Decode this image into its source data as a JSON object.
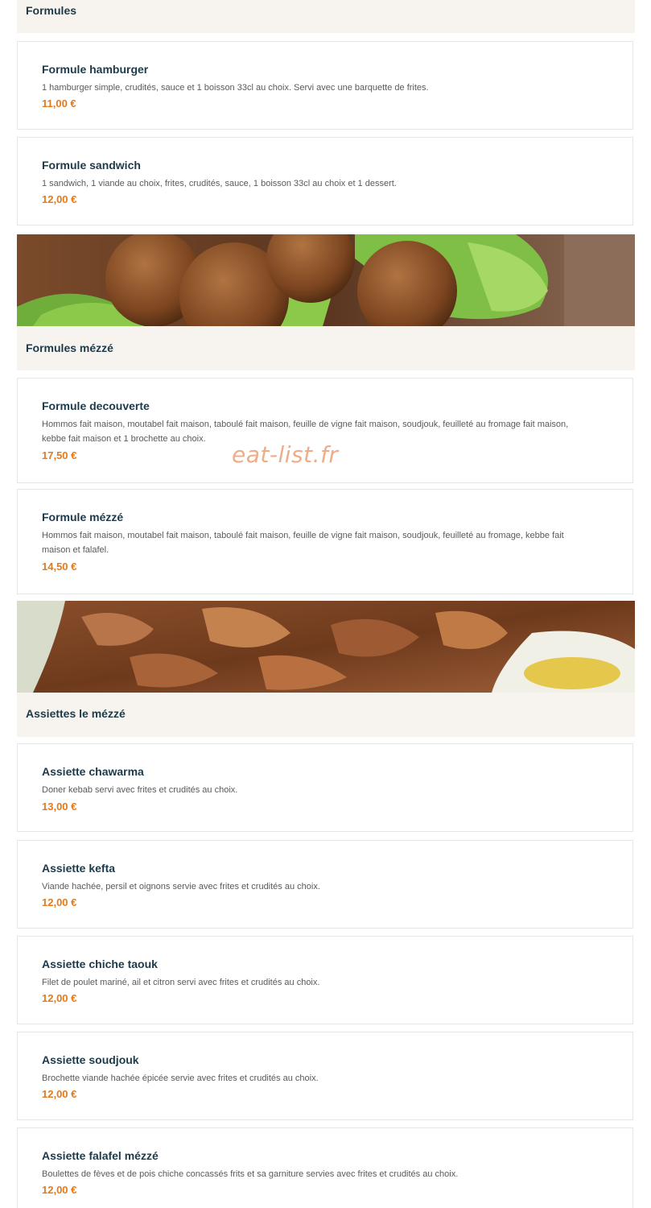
{
  "sections": [
    {
      "title": "Formules",
      "items": [
        {
          "name": "Formule hamburger",
          "desc": "1 hamburger simple, crudités, sauce et 1 boisson 33cl au choix. Servi avec une barquette de frites.",
          "price": "11,00 €"
        },
        {
          "name": "Formule sandwich",
          "desc": "1 sandwich, 1 viande au choix, frites, crudités, sauce, 1 boisson 33cl au choix et 1 dessert.",
          "price": "12,00 €"
        }
      ]
    },
    {
      "title": "Formules mézzé",
      "items": [
        {
          "name": "Formule decouverte",
          "desc": "Hommos fait maison, moutabel fait maison, taboulé fait maison, feuille de vigne fait maison, soudjouk, feuilleté au fromage fait maison, kebbe fait maison et 1 brochette au choix.",
          "price": "17,50 €"
        },
        {
          "name": "Formule mézzé",
          "desc": "Hommos fait maison, moutabel fait maison, taboulé fait maison, feuille de vigne fait maison, soudjouk, feuilleté au fromage, kebbe fait maison et falafel.",
          "price": "14,50 €"
        }
      ]
    },
    {
      "title": "Assiettes le mézzé",
      "items": [
        {
          "name": "Assiette chawarma",
          "desc": "Doner kebab servi avec frites et crudités au choix.",
          "price": "13,00 €"
        },
        {
          "name": "Assiette kefta",
          "desc": "Viande hachée, persil et oignons servie avec frites et crudités au choix.",
          "price": "12,00 €"
        },
        {
          "name": "Assiette chiche taouk",
          "desc": "Filet de poulet mariné, ail et citron servi avec frites et crudités au choix.",
          "price": "12,00 €"
        },
        {
          "name": "Assiette soudjouk",
          "desc": "Brochette viande hachée épicée servie avec frites et crudités au choix.",
          "price": "12,00 €"
        },
        {
          "name": "Assiette falafel mézzé",
          "desc": "Boulettes de fèves et de pois chiche concassés frits et sa garniture servies avec frites et crudités au choix.",
          "price": "12,00 €"
        }
      ]
    }
  ],
  "watermark": "eat-list.fr",
  "colors": {
    "title": "#1d3a4a",
    "price": "#e07a1f",
    "header_bg": "#f7f3ef",
    "card_border": "#e8e6e3"
  }
}
